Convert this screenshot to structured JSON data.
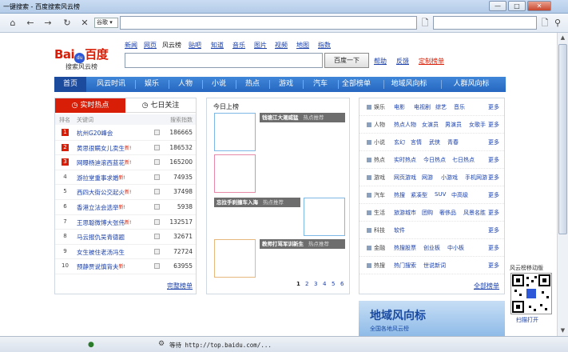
{
  "window": {
    "title": "一键搜索 - 百度搜索风云榜",
    "minimize": "—",
    "maximize": "□",
    "close": "✕"
  },
  "toolbar": {
    "dropdown": "谷歌"
  },
  "logo": {
    "text_bai": "Bai",
    "text_du": "du",
    "text_cn": "百度",
    "subtitle": "搜索风云榜"
  },
  "topnav": [
    "新闻",
    "网页",
    "风云榜",
    "贴吧",
    "知道",
    "音乐",
    "图片",
    "视频",
    "地图",
    "指数"
  ],
  "search": {
    "value": "",
    "button": "百度一下",
    "links": [
      "帮助",
      "反馈",
      "定制榜单"
    ]
  },
  "mainnav": [
    "首页",
    "风云时讯",
    "娱乐",
    "人物",
    "小说",
    "热点",
    "游戏",
    "汽车",
    "全部榜单",
    "地域风向标",
    "人群风向标"
  ],
  "left": {
    "tab_active": "实时热点",
    "tab_other": "七日关注",
    "col_rank": "排名",
    "col_kw": "关键词",
    "col_idx": "搜索指数",
    "rows": [
      {
        "rank": "1",
        "kw": "杭州G20峰会",
        "new": "",
        "num": "186665"
      },
      {
        "rank": "2",
        "kw": "黄思很瞒女儿卖生",
        "new": "新!",
        "num": "186532"
      },
      {
        "rank": "3",
        "kw": "网曝杨迪滚西蓝花",
        "new": "新!",
        "num": "165200"
      },
      {
        "rank": "4",
        "kw": "游拉堂重事求婚",
        "new": "新!",
        "num": "74935"
      },
      {
        "rank": "5",
        "kw": "西四大街公交起火",
        "new": "新!",
        "num": "37498"
      },
      {
        "rank": "6",
        "kw": "香港立法会选举",
        "new": "新!",
        "num": "5938"
      },
      {
        "rank": "7",
        "kw": "王思聪微博大张伟",
        "new": "新!",
        "num": "132517"
      },
      {
        "rank": "8",
        "kw": "马云报仇吴青德题",
        "new": "",
        "num": "32671"
      },
      {
        "rank": "9",
        "kw": "女生被住老汤冯生",
        "new": "",
        "num": "72724"
      },
      {
        "rank": "10",
        "kw": "预静贾说慎背夫",
        "new": "新!",
        "num": "63955"
      }
    ],
    "more": "完整榜单"
  },
  "mid": {
    "title": "今日上榜",
    "captions": [
      {
        "title": "钱塘江大潮威猛",
        "tag": "热点推荐"
      },
      {
        "title": "忘拉手刹撞车入海",
        "tag": "热点推荐"
      },
      {
        "title": "教师打骂军训新生",
        "tag": "热点推荐"
      }
    ],
    "pages": [
      "1",
      "2",
      "3",
      "4",
      "5",
      "6"
    ]
  },
  "right": {
    "cats": [
      {
        "name": "娱乐",
        "links": [
          "电影",
          "电视剧",
          "综艺",
          "音乐"
        ],
        "more": "更多"
      },
      {
        "name": "人物",
        "links": [
          "热点人物",
          "女演员",
          "男演员",
          "女歌手"
        ],
        "more": "更多"
      },
      {
        "name": "小说",
        "links": [
          "玄幻",
          "言情",
          "武侠",
          "青春"
        ],
        "more": "更多"
      },
      {
        "name": "热点",
        "links": [
          "实时热点",
          "今日热点",
          "七日热点"
        ],
        "more": "更多"
      },
      {
        "name": "游戏",
        "links": [
          "网页游戏",
          "网游",
          "小游戏",
          "手机网游"
        ],
        "more": "更多"
      },
      {
        "name": "汽车",
        "links": [
          "热搜",
          "紧凑型",
          "SUV",
          "中高级"
        ],
        "more": "更多"
      },
      {
        "name": "生活",
        "links": [
          "旅游城市",
          "团购",
          "奢侈品",
          "风景名胜"
        ],
        "more": "更多"
      },
      {
        "name": "科技",
        "links": [
          "软件"
        ],
        "more": "更多"
      },
      {
        "name": "金融",
        "links": [
          "热搜股票",
          "创业板",
          "中小板"
        ],
        "more": "更多"
      },
      {
        "name": "热搜",
        "links": [
          "热门搜索",
          "世说新词"
        ],
        "more": "更多"
      }
    ],
    "more": "全部榜单"
  },
  "banner": {
    "title": "地域风向标",
    "sub": "全国各地风云榜"
  },
  "qr": {
    "title": "风云榜移动版",
    "bottom": "扫描打开"
  },
  "status": {
    "text": "等待 http://top.baidu.com/..."
  },
  "colors": {
    "accent": "#2667c1",
    "hot": "#d81e06"
  }
}
